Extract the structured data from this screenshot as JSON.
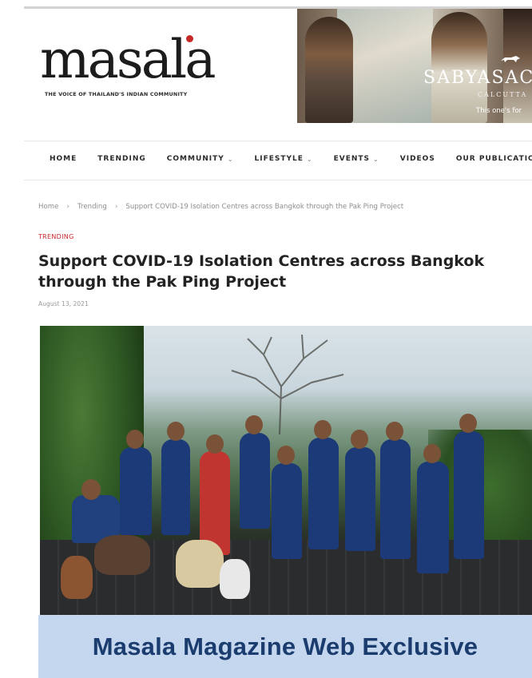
{
  "logo": {
    "wordmark": "masala",
    "tagline": "THE VOICE OF THAILAND'S INDIAN COMMUNITY"
  },
  "banner": {
    "brand": "SABYASAC",
    "sub": "CALCUTTA",
    "tagline": "This one's for"
  },
  "nav": {
    "items": [
      {
        "label": "HOME",
        "dropdown": false
      },
      {
        "label": "TRENDING",
        "dropdown": false
      },
      {
        "label": "COMMUNITY",
        "dropdown": true
      },
      {
        "label": "LIFESTYLE",
        "dropdown": true
      },
      {
        "label": "EVENTS",
        "dropdown": true
      },
      {
        "label": "VIDEOS",
        "dropdown": false
      },
      {
        "label": "OUR PUBLICATIONS",
        "dropdown": true
      }
    ]
  },
  "breadcrumb": {
    "home": "Home",
    "section": "Trending",
    "current": "Support COVID-19 Isolation Centres across Bangkok through the Pak Ping Project",
    "separator": "›"
  },
  "article": {
    "category": "TRENDING",
    "title": "Support COVID-19 Isolation Centres across Bangkok through the Pak Ping Project",
    "date": "August 13, 2021"
  },
  "caption": {
    "text": "Masala Magazine Web Exclusive"
  },
  "colors": {
    "accent_red": "#c62828",
    "caption_bg": "#c5d7ee",
    "caption_text": "#1a3c6e"
  }
}
